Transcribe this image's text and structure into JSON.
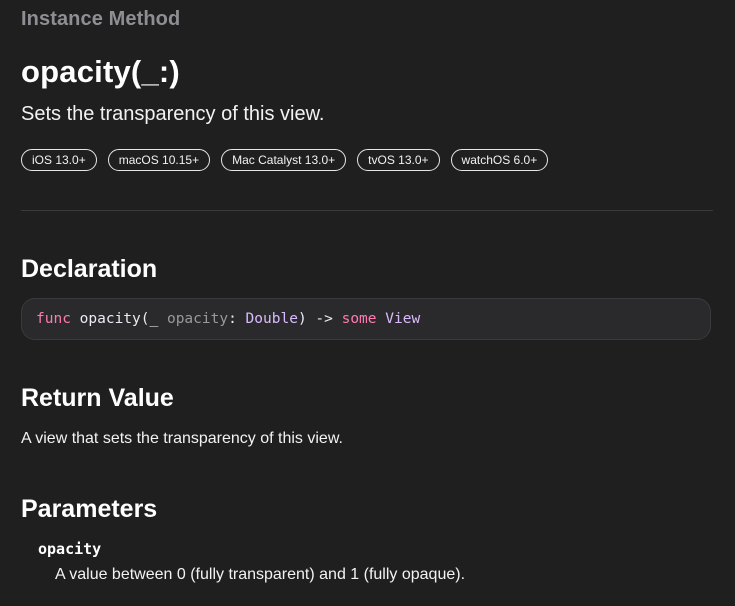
{
  "header": {
    "eyebrow": "Instance Method",
    "title": "opacity(_:)",
    "abstract": "Sets the transparency of this view."
  },
  "platforms": [
    "iOS 13.0+",
    "macOS 10.15+",
    "Mac Catalyst 13.0+",
    "tvOS 13.0+",
    "watchOS 6.0+"
  ],
  "declaration": {
    "heading": "Declaration",
    "kw_func": "func",
    "name": " opacity(",
    "underscore": "_ ",
    "param": "opacity",
    "colon": ": ",
    "type": "Double",
    "arrow": ") -> ",
    "kw_some": "some",
    "space": " ",
    "ret_type": "View"
  },
  "return_value": {
    "heading": "Return Value",
    "text": "A view that sets the transparency of this view."
  },
  "parameters": {
    "heading": "Parameters",
    "items": [
      {
        "name": "opacity",
        "description": "A value between 0 (fully transparent) and 1 (fully opaque)."
      }
    ]
  },
  "colors": {
    "background": "#1f1f1f",
    "keyword": "#ff7ab2",
    "type": "#dabaff",
    "muted": "#8e8e93"
  }
}
